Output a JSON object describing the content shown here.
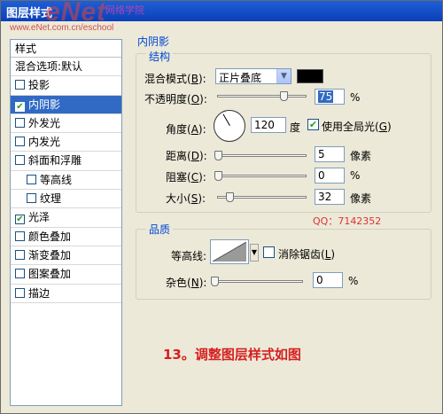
{
  "window": {
    "title": "图层样式",
    "watermark_logo": "eNet",
    "watermark_tagline": "网络学院",
    "watermark_url": "www.eNet.com.cn/eschool"
  },
  "left_panel": {
    "header": "样式",
    "blend_options": "混合选项:默认",
    "items": [
      {
        "label": "投影",
        "checked": false,
        "selected": false,
        "sub": false
      },
      {
        "label": "内阴影",
        "checked": true,
        "selected": true,
        "sub": false
      },
      {
        "label": "外发光",
        "checked": false,
        "selected": false,
        "sub": false
      },
      {
        "label": "内发光",
        "checked": false,
        "selected": false,
        "sub": false
      },
      {
        "label": "斜面和浮雕",
        "checked": false,
        "selected": false,
        "sub": false
      },
      {
        "label": "等高线",
        "checked": false,
        "selected": false,
        "sub": true
      },
      {
        "label": "纹理",
        "checked": false,
        "selected": false,
        "sub": true
      },
      {
        "label": "光泽",
        "checked": true,
        "selected": false,
        "sub": false
      },
      {
        "label": "颜色叠加",
        "checked": false,
        "selected": false,
        "sub": false
      },
      {
        "label": "渐变叠加",
        "checked": false,
        "selected": false,
        "sub": false
      },
      {
        "label": "图案叠加",
        "checked": false,
        "selected": false,
        "sub": false
      },
      {
        "label": "描边",
        "checked": false,
        "selected": false,
        "sub": false
      }
    ]
  },
  "inner_shadow": {
    "section_title": "内阴影",
    "structure": {
      "title": "结构",
      "blend_mode_label": "混合模式",
      "blend_mode_key": "B",
      "blend_mode_value": "正片叠底",
      "shadow_color": "#000000",
      "opacity_label": "不透明度",
      "opacity_key": "O",
      "opacity_value": "75",
      "opacity_unit": "%",
      "angle_label": "角度",
      "angle_key": "A",
      "angle_value": "120",
      "angle_unit": "度",
      "global_light_label": "使用全局光",
      "global_light_key": "G",
      "global_light_checked": true,
      "distance_label": "距离",
      "distance_key": "D",
      "distance_value": "5",
      "distance_unit": "像素",
      "choke_label": "阻塞",
      "choke_key": "C",
      "choke_value": "0",
      "choke_unit": "%",
      "size_label": "大小",
      "size_key": "S",
      "size_value": "32",
      "size_unit": "像素"
    },
    "quality": {
      "title": "品质",
      "contour_label": "等高线:",
      "anti_alias_label": "消除锯齿",
      "anti_alias_key": "L",
      "anti_alias_checked": false,
      "noise_label": "杂色",
      "noise_key": "N",
      "noise_value": "0",
      "noise_unit": "%"
    }
  },
  "overlay": {
    "qq": "QQ：7142352",
    "caption": "13。调整图层样式如图"
  },
  "accent_color": "#316ac5"
}
